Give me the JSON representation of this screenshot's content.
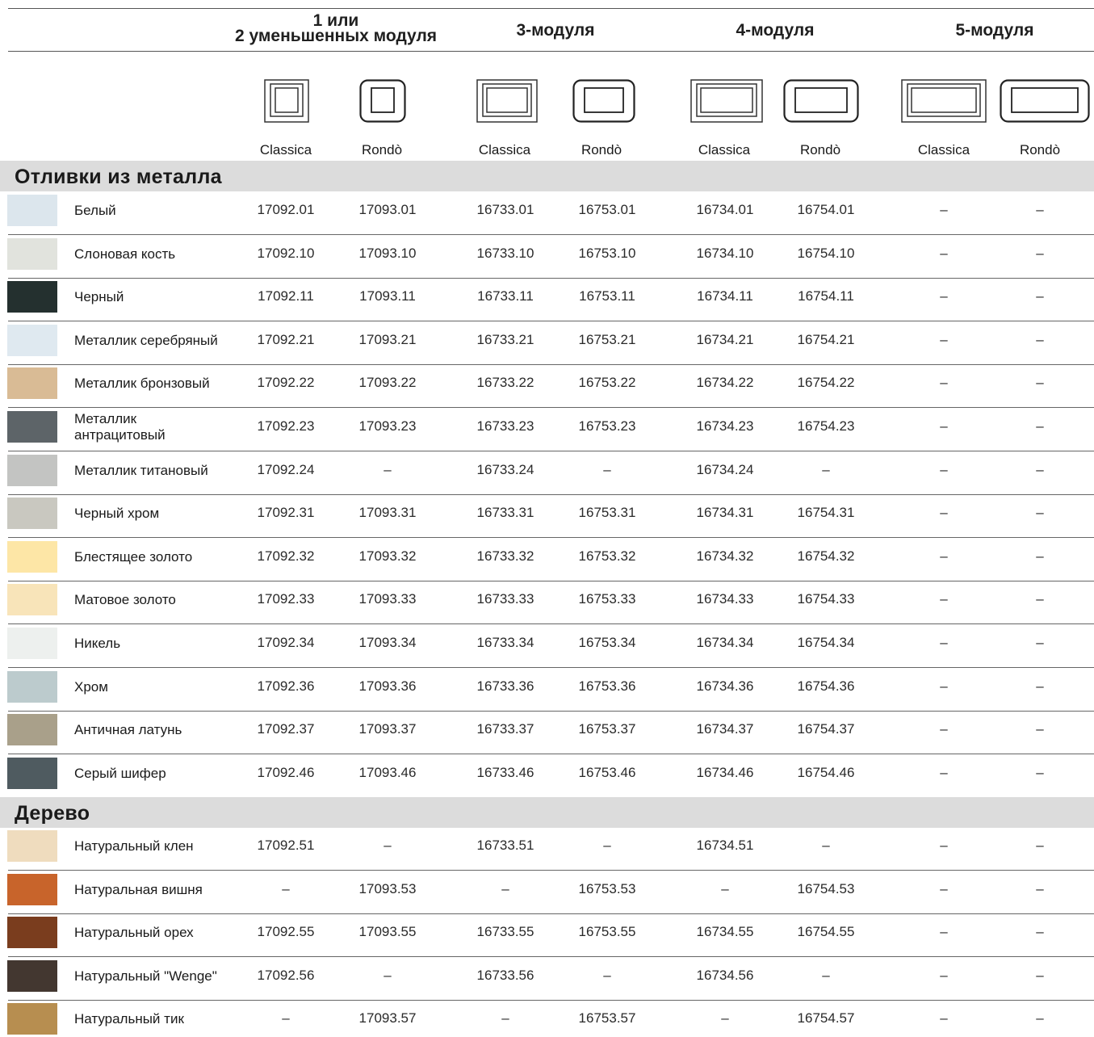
{
  "header": {
    "groups": [
      {
        "label_line1": "1 или",
        "label_line2": "2 уменьшенных модуля"
      },
      {
        "label_line1": "3-модуля",
        "label_line2": ""
      },
      {
        "label_line1": "4-модуля",
        "label_line2": ""
      },
      {
        "label_line1": "5-модуля",
        "label_line2": ""
      }
    ],
    "subheaders": [
      "Classica",
      "Rondò",
      "Classica",
      "Rondò",
      "Classica",
      "Rondò",
      "Classica",
      "Rondò"
    ]
  },
  "sections": [
    {
      "title": "Отливки из металла",
      "rows": [
        {
          "name": "Белый",
          "swatch": "#dce6ed",
          "codes": [
            "17092.01",
            "17093.01",
            "16733.01",
            "16753.01",
            "16734.01",
            "16754.01",
            "–",
            "–"
          ]
        },
        {
          "name": "Слоновая кость",
          "swatch": "#e1e3dd",
          "codes": [
            "17092.10",
            "17093.10",
            "16733.10",
            "16753.10",
            "16734.10",
            "16754.10",
            "–",
            "–"
          ]
        },
        {
          "name": "Черный",
          "swatch": "#24302f",
          "codes": [
            "17092.11",
            "17093.11",
            "16733.11",
            "16753.11",
            "16734.11",
            "16754.11",
            "–",
            "–"
          ]
        },
        {
          "name": "Металлик серебряный",
          "swatch": "#dfe9f0",
          "codes": [
            "17092.21",
            "17093.21",
            "16733.21",
            "16753.21",
            "16734.21",
            "16754.21",
            "–",
            "–"
          ]
        },
        {
          "name": "Металлик бронзовый",
          "swatch": "#d9bb95",
          "codes": [
            "17092.22",
            "17093.22",
            "16733.22",
            "16753.22",
            "16734.22",
            "16754.22",
            "–",
            "–"
          ]
        },
        {
          "name": "Металлик антрацитовый",
          "swatch": "#5d6468",
          "codes": [
            "17092.23",
            "17093.23",
            "16733.23",
            "16753.23",
            "16734.23",
            "16754.23",
            "–",
            "–"
          ]
        },
        {
          "name": "Металлик титановый",
          "swatch": "#c3c4c2",
          "codes": [
            "17092.24",
            "–",
            "16733.24",
            "–",
            "16734.24",
            "–",
            "–",
            "–"
          ]
        },
        {
          "name": "Черный хром",
          "swatch": "#c9c8c0",
          "codes": [
            "17092.31",
            "17093.31",
            "16733.31",
            "16753.31",
            "16734.31",
            "16754.31",
            "–",
            "–"
          ]
        },
        {
          "name": "Блестящее золото",
          "swatch": "#fde6a6",
          "codes": [
            "17092.32",
            "17093.32",
            "16733.32",
            "16753.32",
            "16734.32",
            "16754.32",
            "–",
            "–"
          ]
        },
        {
          "name": "Матовое золото",
          "swatch": "#f8e4b9",
          "codes": [
            "17092.33",
            "17093.33",
            "16733.33",
            "16753.33",
            "16734.33",
            "16754.33",
            "–",
            "–"
          ]
        },
        {
          "name": "Никель",
          "swatch": "#edf0ee",
          "codes": [
            "17092.34",
            "17093.34",
            "16733.34",
            "16753.34",
            "16734.34",
            "16754.34",
            "–",
            "–"
          ]
        },
        {
          "name": "Хром",
          "swatch": "#bccbcd",
          "codes": [
            "17092.36",
            "17093.36",
            "16733.36",
            "16753.36",
            "16734.36",
            "16754.36",
            "–",
            "–"
          ]
        },
        {
          "name": "Античная латунь",
          "swatch": "#a9a08a",
          "codes": [
            "17092.37",
            "17093.37",
            "16733.37",
            "16753.37",
            "16734.37",
            "16754.37",
            "–",
            "–"
          ]
        },
        {
          "name": "Серый шифер",
          "swatch": "#4f5b60",
          "codes": [
            "17092.46",
            "17093.46",
            "16733.46",
            "16753.46",
            "16734.46",
            "16754.46",
            "–",
            "–"
          ]
        }
      ]
    },
    {
      "title": "Дерево",
      "rows": [
        {
          "name": "Натуральный клен",
          "swatch": "#efdcbe",
          "codes": [
            "17092.51",
            "–",
            "16733.51",
            "–",
            "16734.51",
            "–",
            "–",
            "–"
          ]
        },
        {
          "name": "Натуральная вишня",
          "swatch": "#c8642b",
          "codes": [
            "–",
            "17093.53",
            "–",
            "16753.53",
            "–",
            "16754.53",
            "–",
            "–"
          ]
        },
        {
          "name": "Натуральный орех",
          "swatch": "#7a3d1e",
          "codes": [
            "17092.55",
            "17093.55",
            "16733.55",
            "16753.55",
            "16734.55",
            "16754.55",
            "–",
            "–"
          ]
        },
        {
          "name": "Натуральный \"Wenge\"",
          "swatch": "#433730",
          "codes": [
            "17092.56",
            "–",
            "16733.56",
            "–",
            "16734.56",
            "–",
            "–",
            "–"
          ]
        },
        {
          "name": "Натуральный тик",
          "swatch": "#b78e50",
          "codes": [
            "–",
            "17093.57",
            "–",
            "16753.57",
            "–",
            "16754.57",
            "–",
            "–"
          ]
        }
      ]
    }
  ]
}
